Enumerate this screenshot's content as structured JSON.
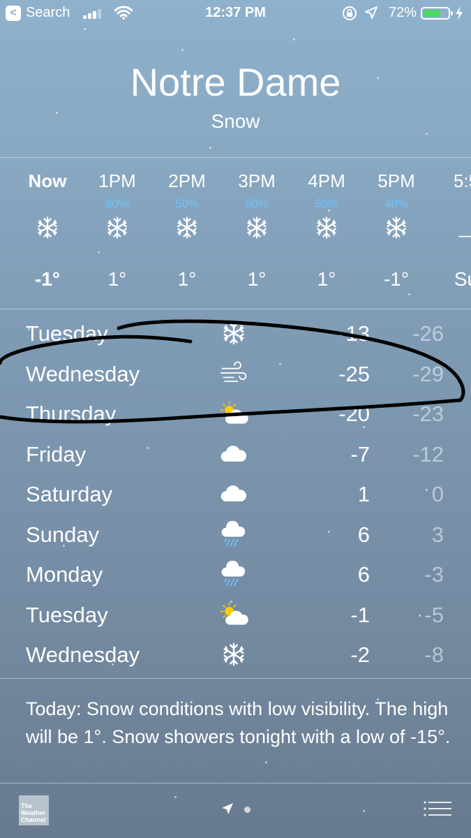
{
  "status_bar": {
    "back_label": "Search",
    "time": "12:37 PM",
    "battery_percent": "72%",
    "battery_level": 0.72,
    "battery_color": "#4cd964"
  },
  "location": {
    "city": "Notre Dame",
    "condition": "Snow"
  },
  "hourly": [
    {
      "time": "Now",
      "precip": "",
      "icon": "snowflake-icon",
      "temp": "-1°"
    },
    {
      "time": "1PM",
      "precip": "80%",
      "icon": "snowflake-icon",
      "temp": "1°"
    },
    {
      "time": "2PM",
      "precip": "50%",
      "icon": "snowflake-icon",
      "temp": "1°"
    },
    {
      "time": "3PM",
      "precip": "50%",
      "icon": "snowflake-icon",
      "temp": "1°"
    },
    {
      "time": "4PM",
      "precip": "50%",
      "icon": "snowflake-icon",
      "temp": "1°"
    },
    {
      "time": "5PM",
      "precip": "40%",
      "icon": "snowflake-icon",
      "temp": "-1°"
    },
    {
      "time": "5:5",
      "precip": "",
      "icon": "sunset-icon",
      "temp": "Su"
    }
  ],
  "daily": [
    {
      "day": "Tuesday",
      "icon": "snowflake-icon",
      "high": "-13",
      "low": "-26"
    },
    {
      "day": "Wednesday",
      "icon": "wind-icon",
      "high": "-25",
      "low": "-29"
    },
    {
      "day": "Thursday",
      "icon": "partly-sunny-icon",
      "high": "-20",
      "low": "-23"
    },
    {
      "day": "Friday",
      "icon": "cloud-icon",
      "high": "-7",
      "low": "-12"
    },
    {
      "day": "Saturday",
      "icon": "cloud-icon",
      "high": "1",
      "low": "0"
    },
    {
      "day": "Sunday",
      "icon": "rain-cloud-icon",
      "high": "6",
      "low": "3"
    },
    {
      "day": "Monday",
      "icon": "rain-cloud-icon",
      "high": "6",
      "low": "-3"
    },
    {
      "day": "Tuesday",
      "icon": "partly-sunny-icon",
      "high": "-1",
      "low": "-5"
    },
    {
      "day": "Wednesday",
      "icon": "snowflake-icon",
      "high": "-2",
      "low": "-8"
    }
  ],
  "summary": "Today: Snow conditions with low visibility. The high will be 1°. Snow showers tonight with a low of -15°.",
  "toolbar": {
    "logo_text": "The Weather Channel"
  },
  "colors": {
    "precip": "#6ac3ff",
    "annotation": "#000000"
  }
}
